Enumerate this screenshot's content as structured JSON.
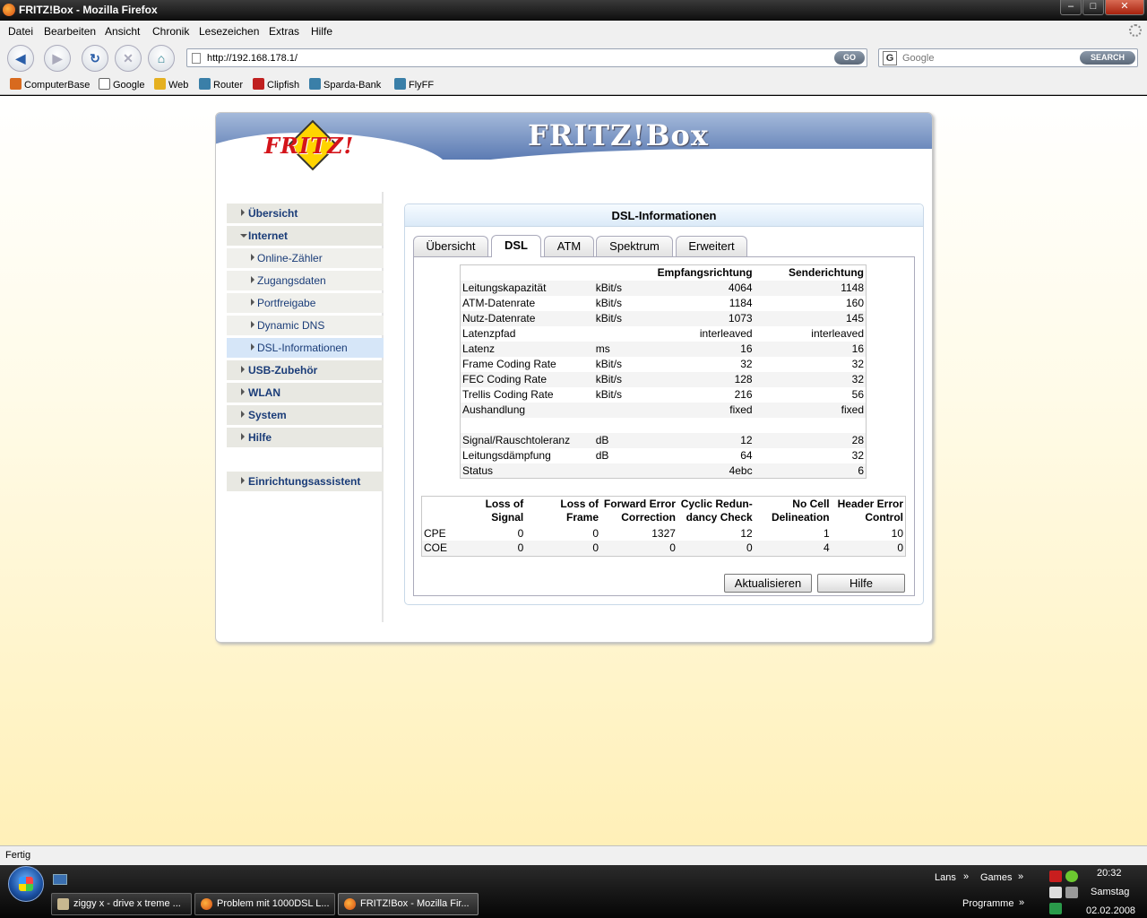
{
  "window": {
    "title": "FRITZ!Box - Mozilla Firefox",
    "controls": [
      "–",
      "□",
      "✕"
    ]
  },
  "menu": [
    "Datei",
    "Bearbeiten",
    "Ansicht",
    "Chronik",
    "Lesezeichen",
    "Extras",
    "Hilfe"
  ],
  "nav": {
    "back": "◀",
    "forward": "▶",
    "reload": "↻",
    "stop": "✕",
    "home": "⌂",
    "url": "http://192.168.178.1/",
    "go_label": "GO",
    "search_placeholder": "Google",
    "search_label": "SEARCH"
  },
  "bookmarks": [
    "ComputerBase",
    "Google",
    "Web",
    "Router",
    "Clipfish",
    "Sparda-Bank",
    "FlyFF"
  ],
  "fritz": {
    "logo": "FRITZ!",
    "brand": "FRITZ!Box",
    "menu": {
      "uebersicht": "Übersicht",
      "internet": "Internet",
      "online_zaehler": "Online-Zähler",
      "zugangsdaten": "Zugangsdaten",
      "portfreigabe": "Portfreigabe",
      "dynamic_dns": "Dynamic DNS",
      "dsl_info": "DSL-Informationen",
      "usb": "USB-Zubehör",
      "wlan": "WLAN",
      "system": "System",
      "hilfe": "Hilfe",
      "assistent": "Einrichtungsassistent"
    },
    "panel_title": "DSL-Informationen",
    "tabs": [
      "Übersicht",
      "DSL",
      "ATM",
      "Spektrum",
      "Erweitert"
    ],
    "dsl_headers": [
      "",
      "",
      "Empfangsrichtung",
      "Senderichtung"
    ],
    "dsl_rows": [
      [
        "Leitungskapazität",
        "kBit/s",
        "4064",
        "1148"
      ],
      [
        "ATM-Datenrate",
        "kBit/s",
        "1184",
        "160"
      ],
      [
        "Nutz-Datenrate",
        "kBit/s",
        "1073",
        "145"
      ],
      [
        "Latenzpfad",
        "",
        "interleaved",
        "interleaved"
      ],
      [
        "Latenz",
        "ms",
        "16",
        "16"
      ],
      [
        "Frame Coding Rate",
        "kBit/s",
        "32",
        "32"
      ],
      [
        "FEC Coding Rate",
        "kBit/s",
        "128",
        "32"
      ],
      [
        "Trellis Coding Rate",
        "kBit/s",
        "216",
        "56"
      ],
      [
        "Aushandlung",
        "",
        "fixed",
        "fixed"
      ],
      [
        "",
        "",
        "",
        ""
      ],
      [
        "Signal/Rauschtoleranz",
        "dB",
        "12",
        "28"
      ],
      [
        "Leitungsdämpfung",
        "dB",
        "64",
        "32"
      ],
      [
        "Status",
        "",
        "4ebc",
        "6"
      ]
    ],
    "err_headers": [
      [
        "",
        ""
      ],
      [
        "Loss of",
        "Signal"
      ],
      [
        "Loss of",
        "Frame"
      ],
      [
        "Forward Error",
        "Correction"
      ],
      [
        "Cyclic Redun-",
        "dancy Check"
      ],
      [
        "No Cell",
        "Delineation"
      ],
      [
        "Header Error",
        "Control"
      ]
    ],
    "err_rows": [
      [
        "CPE",
        "0",
        "0",
        "1327",
        "12",
        "1",
        "10"
      ],
      [
        "COE",
        "0",
        "0",
        "0",
        "0",
        "4",
        "0"
      ]
    ],
    "btn_refresh": "Aktualisieren",
    "btn_help": "Hilfe"
  },
  "status": "Fertig",
  "taskbar": {
    "tasks": [
      "ziggy x - drive x treme ...",
      "Problem mit 1000DSL L...",
      "FRITZ!Box - Mozilla Fir..."
    ],
    "toolbar_lans": "Lans",
    "toolbar_games": "Games",
    "toolbar_programme": "Programme",
    "chev": "»",
    "time": "20:32",
    "day": "Samstag",
    "date": "02.02.2008"
  }
}
